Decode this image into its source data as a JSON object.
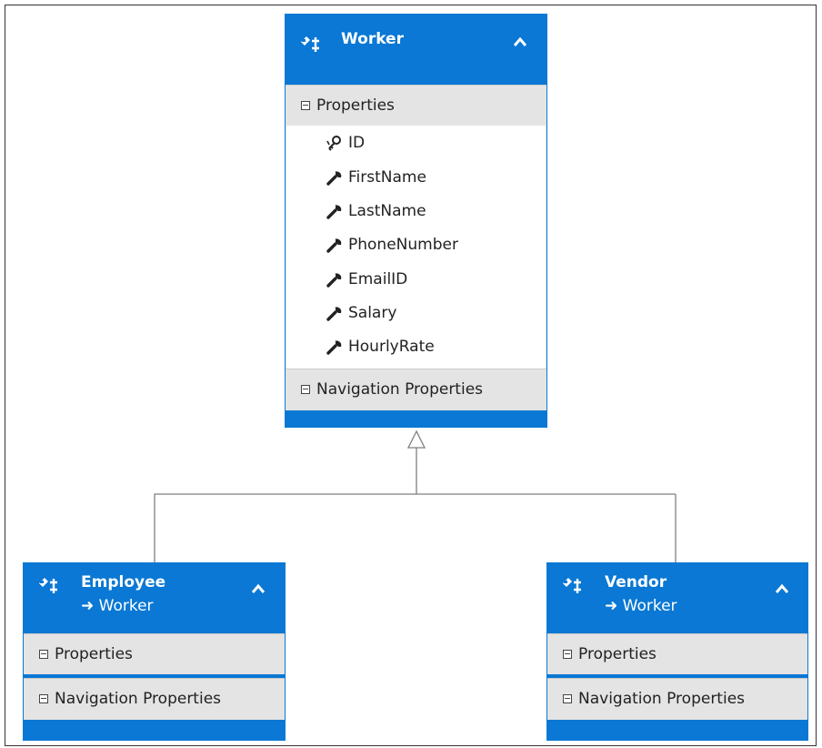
{
  "colors": {
    "entity_header": "#0a78d4",
    "section_bg": "#e4e4e4",
    "connector": "#7f7f7f"
  },
  "worker": {
    "title": "Worker",
    "properties_label": "Properties",
    "navigation_label": "Navigation Properties",
    "key_property": "ID",
    "properties": [
      "FirstName",
      "LastName",
      "PhoneNumber",
      "EmailID",
      "Salary",
      "HourlyRate"
    ]
  },
  "employee": {
    "title": "Employee",
    "base_type": "Worker",
    "properties_label": "Properties",
    "navigation_label": "Navigation Properties"
  },
  "vendor": {
    "title": "Vendor",
    "base_type": "Worker",
    "properties_label": "Properties",
    "navigation_label": "Navigation Properties"
  },
  "icons": {
    "entity": "entity-type-icon",
    "key": "key-icon",
    "property": "wrench-icon",
    "collapse": "chevron-up-icon",
    "section_toggle": "minus-box-icon",
    "inheritance": "arrow-right-icon"
  }
}
